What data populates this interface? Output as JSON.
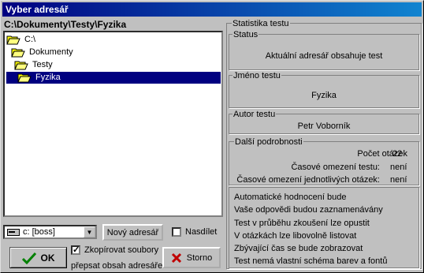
{
  "window": {
    "title": "Vyber adresář"
  },
  "path": "C:\\Dokumenty\\Testy\\Fyzika",
  "tree": [
    {
      "label": "C:\\",
      "open": true
    },
    {
      "label": "Dokumenty",
      "open": true
    },
    {
      "label": "Testy",
      "open": true
    },
    {
      "label": "Fyzika",
      "open": true,
      "selected": true
    }
  ],
  "drive": {
    "value": "c: [boss]"
  },
  "buttons": {
    "new_dir": "Nový adresář",
    "ok": "OK",
    "cancel": "Storno"
  },
  "checkboxes": {
    "inherit": {
      "label": "Nasdílet",
      "checked": false
    },
    "copy": {
      "label": "Zkopírovat soubory",
      "checked": true
    },
    "overwrite_note": "přepsat obsah adresáře"
  },
  "stats": {
    "title": "Statistika testu",
    "status": {
      "label": "Status",
      "value": "Aktuální adresář obsahuje test"
    },
    "name": {
      "label": "Jméno testu",
      "value": "Fyzika"
    },
    "author": {
      "label": "Autor testu",
      "value": "Petr Voborník"
    },
    "details": {
      "label": "Další podrobnosti",
      "rows": [
        {
          "key": "Počet otázek",
          "value": "22"
        },
        {
          "key": "Časové omezení testu:",
          "value": "není"
        },
        {
          "key": "Časové omezení jednotlivých otázek:",
          "value": "není"
        }
      ]
    },
    "lines": [
      "Automatické hodnocení bude",
      "Vaše odpovědi budou zaznamenávány",
      "Test v průběhu zkoušení lze opustit",
      "V otázkách lze libovolně listovat",
      "Zbývající čas se bude zobrazovat",
      "Test nemá vlastní schéma barev a fontů"
    ]
  },
  "colors": {
    "title_bg": "#000080",
    "selection": "#000080",
    "face": "#c0c0c0",
    "ok_check": "#008000",
    "cancel_x": "#c00000"
  }
}
